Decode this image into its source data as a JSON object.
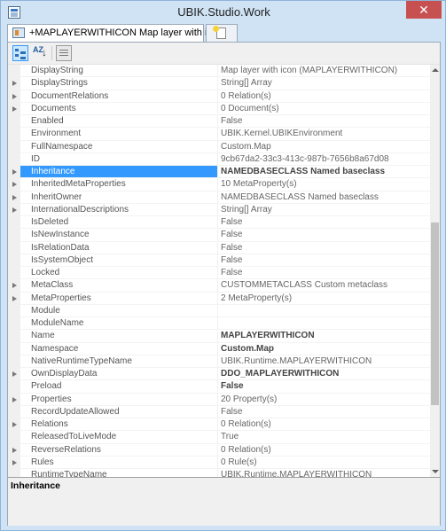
{
  "window": {
    "title": "UBIK.Studio.Work",
    "close_label": "✕"
  },
  "tabs": {
    "active_label": "+MAPLAYERWITHICON Map layer with icon"
  },
  "toolbar": {
    "categorized_icon": "categorized-view-icon",
    "alphabetical_label": "AZ",
    "pages_icon": "property-pages-icon"
  },
  "properties": [
    {
      "name": "DisplayString",
      "value": "Map layer with icon (MAPLAYERWITHICON)",
      "expandable": false,
      "bold": false
    },
    {
      "name": "DisplayStrings",
      "value": "String[] Array",
      "expandable": true,
      "bold": false
    },
    {
      "name": "DocumentRelations",
      "value": "0 Relation(s)",
      "expandable": true,
      "bold": false
    },
    {
      "name": "Documents",
      "value": "0 Document(s)",
      "expandable": true,
      "bold": false
    },
    {
      "name": "Enabled",
      "value": "False",
      "expandable": false,
      "bold": false
    },
    {
      "name": "Environment",
      "value": "UBIK.Kernel.UBIKEnvironment",
      "expandable": false,
      "bold": false
    },
    {
      "name": "FullNamespace",
      "value": "Custom.Map",
      "expandable": false,
      "bold": false
    },
    {
      "name": "ID",
      "value": "9cb67da2-33c3-413c-987b-7656b8a67d08",
      "expandable": false,
      "bold": false
    },
    {
      "name": "Inheritance",
      "value": "NAMEDBASECLASS Named baseclass",
      "expandable": true,
      "bold": true,
      "selected": true
    },
    {
      "name": "InheritedMetaProperties",
      "value": "10 MetaProperty(s)",
      "expandable": true,
      "bold": false
    },
    {
      "name": "InheritOwner",
      "value": "NAMEDBASECLASS Named baseclass",
      "expandable": true,
      "bold": false
    },
    {
      "name": "InternationalDescriptions",
      "value": "String[] Array",
      "expandable": true,
      "bold": false
    },
    {
      "name": "IsDeleted",
      "value": "False",
      "expandable": false,
      "bold": false
    },
    {
      "name": "IsNewInstance",
      "value": "False",
      "expandable": false,
      "bold": false
    },
    {
      "name": "IsRelationData",
      "value": "False",
      "expandable": false,
      "bold": false
    },
    {
      "name": "IsSystemObject",
      "value": "False",
      "expandable": false,
      "bold": false
    },
    {
      "name": "Locked",
      "value": "False",
      "expandable": false,
      "bold": false
    },
    {
      "name": "MetaClass",
      "value": "CUSTOMMETACLASS Custom metaclass",
      "expandable": true,
      "bold": false
    },
    {
      "name": "MetaProperties",
      "value": "2 MetaProperty(s)",
      "expandable": true,
      "bold": false
    },
    {
      "name": "Module",
      "value": "",
      "expandable": false,
      "bold": false
    },
    {
      "name": "ModuleName",
      "value": "",
      "expandable": false,
      "bold": false
    },
    {
      "name": "Name",
      "value": "MAPLAYERWITHICON",
      "expandable": false,
      "bold": true
    },
    {
      "name": "Namespace",
      "value": "Custom.Map",
      "expandable": false,
      "bold": true
    },
    {
      "name": "NativeRuntimeTypeName",
      "value": "UBIK.Runtime.MAPLAYERWITHICON",
      "expandable": false,
      "bold": false
    },
    {
      "name": "OwnDisplayData",
      "value": "DDO_MAPLAYERWITHICON",
      "expandable": true,
      "bold": true
    },
    {
      "name": "Preload",
      "value": "False",
      "expandable": false,
      "bold": true
    },
    {
      "name": "Properties",
      "value": "20 Property(s)",
      "expandable": true,
      "bold": false
    },
    {
      "name": "RecordUpdateAllowed",
      "value": "False",
      "expandable": false,
      "bold": false
    },
    {
      "name": "Relations",
      "value": "0 Relation(s)",
      "expandable": true,
      "bold": false
    },
    {
      "name": "ReleasedToLiveMode",
      "value": "True",
      "expandable": false,
      "bold": false
    },
    {
      "name": "ReverseRelations",
      "value": "0 Relation(s)",
      "expandable": true,
      "bold": false
    },
    {
      "name": "Rules",
      "value": "0 Rule(s)",
      "expandable": true,
      "bold": false
    },
    {
      "name": "RuntimeTypeName",
      "value": "UBIK.Runtime.MAPLAYERWITHICON",
      "expandable": false,
      "bold": false
    }
  ],
  "description": {
    "title": "Inheritance",
    "text": ""
  }
}
